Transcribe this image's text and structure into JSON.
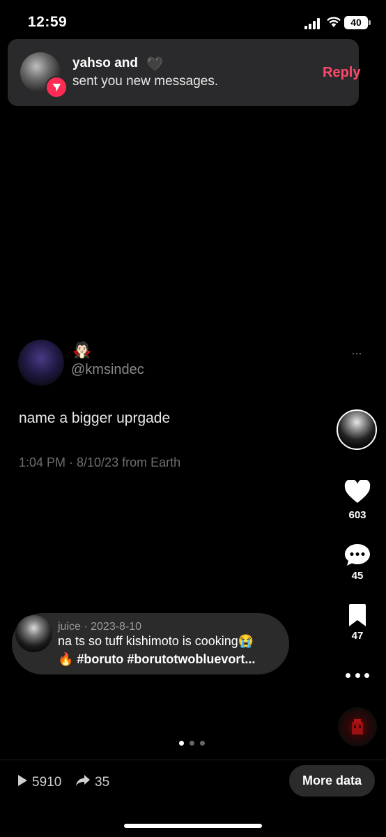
{
  "status_bar": {
    "time": "12:59",
    "battery": "40"
  },
  "notification": {
    "title": "yahso and",
    "title_emoji": "🖤",
    "subtitle": "sent you new messages.",
    "reply_label": "Reply",
    "accent": "#fe2c55"
  },
  "tweet": {
    "emoji": "🧛🏻",
    "handle": "@kmsindec",
    "text": "name a bigger uprgade",
    "meta": "1:04 PM · 8/10/23 from Earth",
    "more": "···"
  },
  "rail": {
    "likes": "603",
    "comments": "45",
    "saves": "47",
    "more": "•••"
  },
  "comment": {
    "author": "juice · 2023-8-10",
    "line1": "na ts so tuff kishimoto is cooking😭",
    "line2": "🔥 #boruto #borutotwobluevort..."
  },
  "pagination": {
    "total": 3,
    "active": 0
  },
  "bottom": {
    "plays": "5910",
    "shares": "35",
    "more_data_label": "More data"
  }
}
